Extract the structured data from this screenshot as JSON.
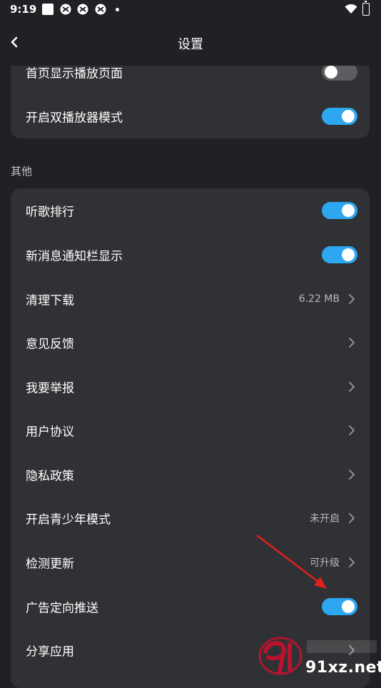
{
  "status_bar": {
    "time": "9:19"
  },
  "header": {
    "title": "设置"
  },
  "top_group": {
    "items": [
      {
        "label": "首页显示播放页面",
        "type": "toggle",
        "on": false
      },
      {
        "label": "开启双播放器模式",
        "type": "toggle",
        "on": true
      }
    ]
  },
  "other_section": {
    "title": "其他",
    "items": [
      {
        "label": "听歌排行",
        "type": "toggle",
        "on": true
      },
      {
        "label": "新消息通知栏显示",
        "type": "toggle",
        "on": true
      },
      {
        "label": "清理下载",
        "type": "link",
        "value": "6.22 MB"
      },
      {
        "label": "意见反馈",
        "type": "link"
      },
      {
        "label": "我要举报",
        "type": "link"
      },
      {
        "label": "用户协议",
        "type": "link"
      },
      {
        "label": "隐私政策",
        "type": "link"
      },
      {
        "label": "开启青少年模式",
        "type": "link",
        "value": "未开启"
      },
      {
        "label": "检测更新",
        "type": "link",
        "value": "可升级"
      },
      {
        "label": "广告定向推送",
        "type": "toggle",
        "on": true
      },
      {
        "label": "分享应用",
        "type": "link"
      }
    ]
  },
  "watermark": {
    "text": "91xz.net"
  },
  "colors": {
    "accent": "#2ea7f1",
    "background": "#202124",
    "card": "#303134",
    "annotation": "#e0201f"
  },
  "icons": {
    "back": "chevron-left-icon",
    "row": "chevron-right-icon"
  }
}
